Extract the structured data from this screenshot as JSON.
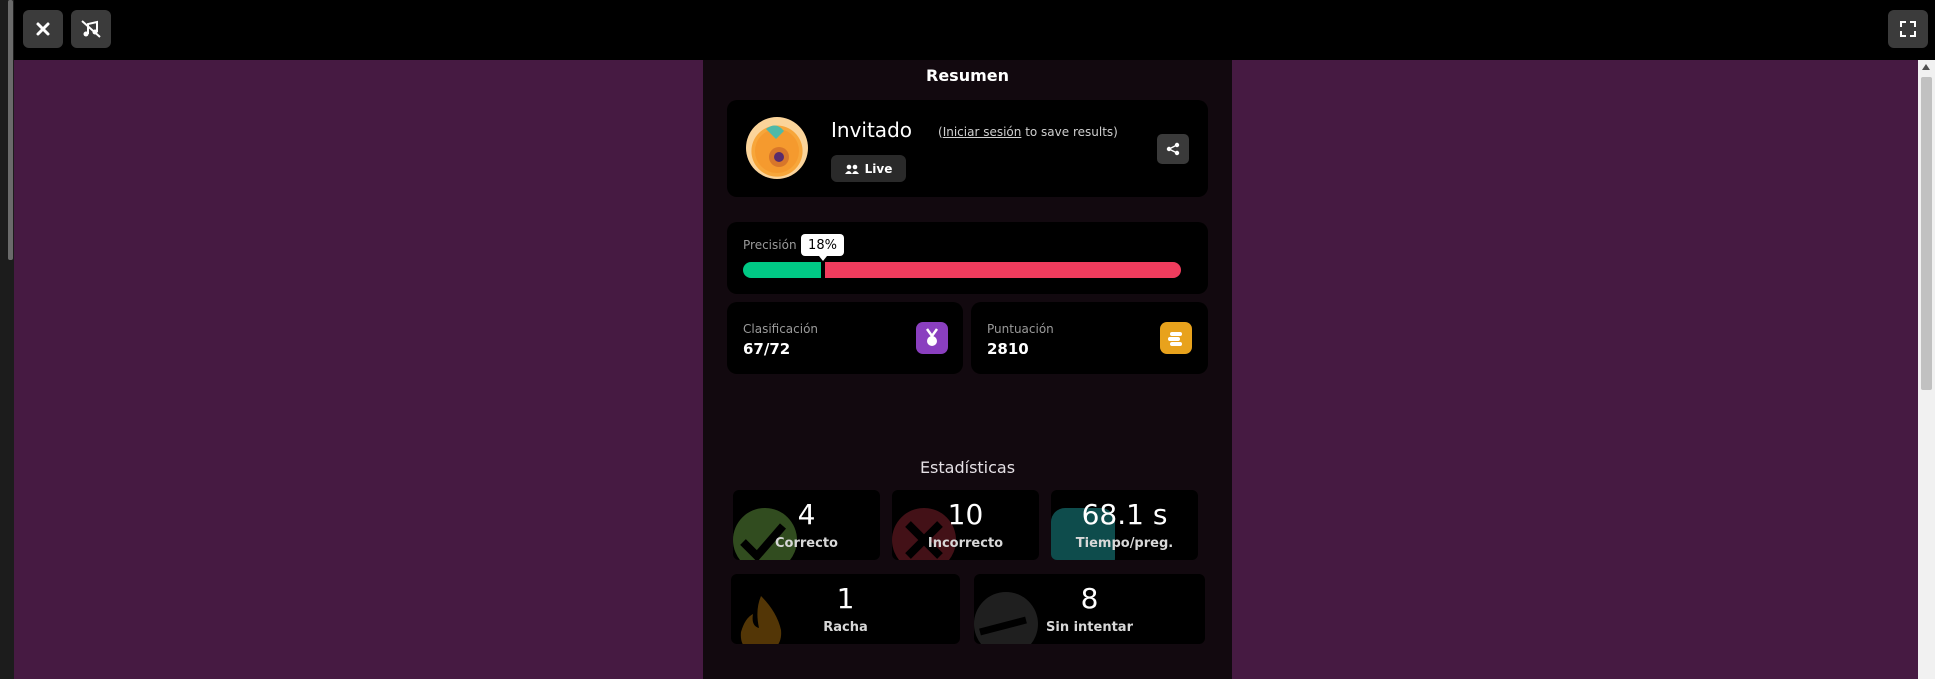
{
  "colors": {
    "page_bg": "#461a42",
    "panel_bg": "#12090f",
    "green": "#00c985",
    "red": "#ef3c5d",
    "purple": "#8a3fbf",
    "orange": "#e8a21c"
  },
  "topbar": {
    "close_icon": "close-icon",
    "mute_icon": "music-off-icon",
    "fullscreen_icon": "fullscreen-icon"
  },
  "summary": {
    "title": "Resumen",
    "player": {
      "name": "Invitado",
      "signin_open": "(",
      "signin_link": "Iniciar sesión",
      "signin_rest": " to save results)",
      "mode_label": "Live"
    },
    "accuracy": {
      "label": "Precisión",
      "value": "18%",
      "fraction": 0.18
    },
    "rank": {
      "label": "Clasificación",
      "value": "67/72"
    },
    "score": {
      "label": "Puntuación",
      "value": "2810"
    }
  },
  "stats": {
    "title": "Estadísticas",
    "items": [
      {
        "value": "4",
        "label": "Correcto"
      },
      {
        "value": "10",
        "label": "Incorrecto"
      },
      {
        "value": "68.1 s",
        "label": "Tiempo/preg."
      },
      {
        "value": "1",
        "label": "Racha"
      },
      {
        "value": "8",
        "label": "Sin intentar"
      }
    ]
  }
}
